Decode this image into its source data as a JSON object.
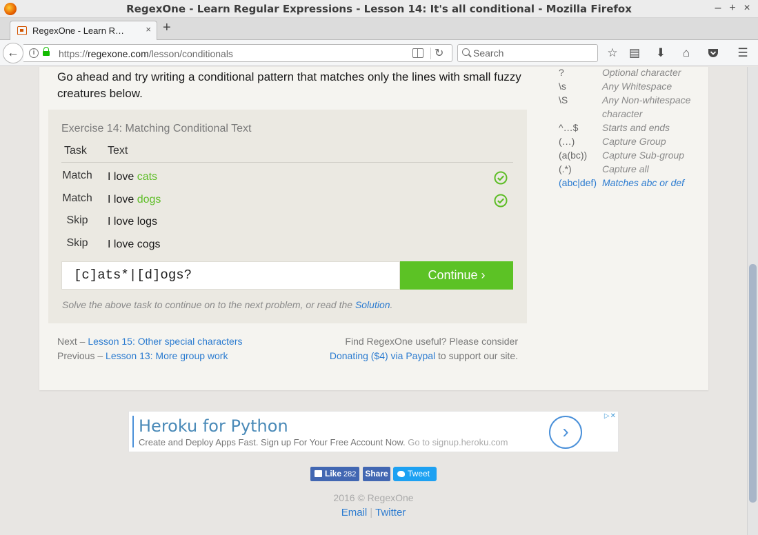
{
  "window": {
    "title": "RegexOne - Learn Regular Expressions - Lesson 14: It's all conditional - Mozilla Firefox",
    "controls": {
      "minimize": "–",
      "maximize": "+",
      "close": "×"
    }
  },
  "tab": {
    "label": "RegexOne - Learn R…",
    "close": "×",
    "new_tab": "+"
  },
  "navbar": {
    "url_scheme": "https://",
    "url_host": "regexone.com",
    "url_path": "/lesson/conditionals",
    "search_placeholder": "Search",
    "icons": [
      "back-icon",
      "info-icon",
      "lock-icon",
      "reader-view-icon",
      "reload-icon",
      "search-icon",
      "bookmark-star-icon",
      "reading-list-icon",
      "download-icon",
      "home-icon",
      "pocket-icon",
      "menu-icon"
    ]
  },
  "lesson": {
    "intro": "Go ahead and try writing a conditional pattern that matches only the lines with small fuzzy creatures below.",
    "exercise": {
      "title": "Exercise 14: Matching Conditional Text",
      "col_task": "Task",
      "col_text": "Text",
      "rows": [
        {
          "task": "Match",
          "prefix": "I love ",
          "highlight": "cats",
          "matched": true
        },
        {
          "task": "Match",
          "prefix": "I love ",
          "highlight": "dogs",
          "matched": true
        },
        {
          "task": "Skip",
          "prefix": "I love logs",
          "highlight": "",
          "matched": false
        },
        {
          "task": "Skip",
          "prefix": "I love cogs",
          "highlight": "",
          "matched": false
        }
      ],
      "answer": "[c]ats*|[d]ogs?",
      "continue_label": "Continue ›",
      "solve_note": "Solve the above task to continue on to the next problem, or read the ",
      "solution_link": "Solution",
      "solve_note_end": "."
    },
    "nav": {
      "next_prefix": "Next – ",
      "next_link": "Lesson 15: Other special characters",
      "prev_prefix": "Previous – ",
      "prev_link": "Lesson 13: More group work",
      "donate_line1": "Find RegexOne useful? Please consider",
      "donate_link": "Donating ($4) via Paypal",
      "donate_suffix": " to support our site."
    }
  },
  "cheatsheet": [
    {
      "sym": "?",
      "desc": "Optional character"
    },
    {
      "sym": "\\s",
      "desc": "Any Whitespace"
    },
    {
      "sym": "\\S",
      "desc": "Any Non-whitespace character"
    },
    {
      "sym": "^…$",
      "desc": "Starts and ends"
    },
    {
      "sym": "(…)",
      "desc": "Capture Group"
    },
    {
      "sym": "(a(bc))",
      "desc": "Capture Sub-group"
    },
    {
      "sym": "(.*)",
      "desc": "Capture all"
    },
    {
      "sym": "(abc|def)",
      "desc": "Matches abc or def"
    }
  ],
  "ad": {
    "title": "Heroku for Python",
    "subtitle": "Create and Deploy Apps Fast. Sign up For Your Free Account Now.",
    "subtitle_muted": " Go to signup.heroku.com",
    "arrow": "›",
    "choices": "▷✕"
  },
  "social": {
    "like": "Like",
    "like_count": "282",
    "share": "Share",
    "tweet": "Tweet"
  },
  "footer": {
    "copyright": "2016 © RegexOne",
    "email": "Email",
    "twitter": "Twitter",
    "separator": "|"
  },
  "colors": {
    "accent_green": "#5cc225",
    "link_blue": "#2b7bd0",
    "match_green": "#5dbd26"
  }
}
